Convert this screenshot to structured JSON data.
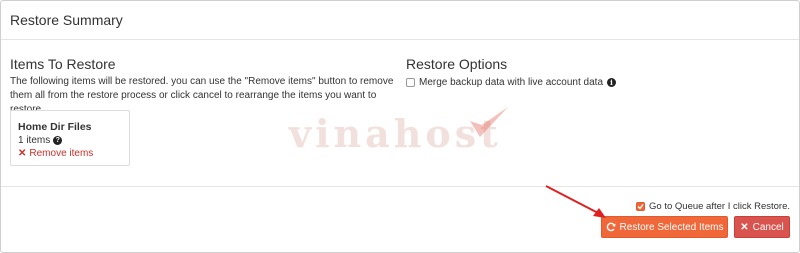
{
  "modal": {
    "title": "Restore Summary"
  },
  "items_section": {
    "title": "Items To Restore",
    "description": "The following items will be restored. you can use the \"Remove items\" button to remove them all from the restore process or click cancel to rearrange the items you want to restore",
    "card": {
      "name": "Home Dir Files",
      "count": "1 items",
      "remove_label": "Remove items"
    }
  },
  "options_section": {
    "title": "Restore Options",
    "merge_label": "Merge backup data with live account data",
    "merge_checked": false
  },
  "watermark": {
    "text": "vinahost"
  },
  "footer": {
    "queue_label": "Go to Queue after I click Restore.",
    "queue_checked": true,
    "restore_button": "Restore Selected Items",
    "cancel_button": "Cancel"
  },
  "colors": {
    "accent": "#f0683a",
    "danger": "#d9534f",
    "arrow": "#e02020"
  }
}
